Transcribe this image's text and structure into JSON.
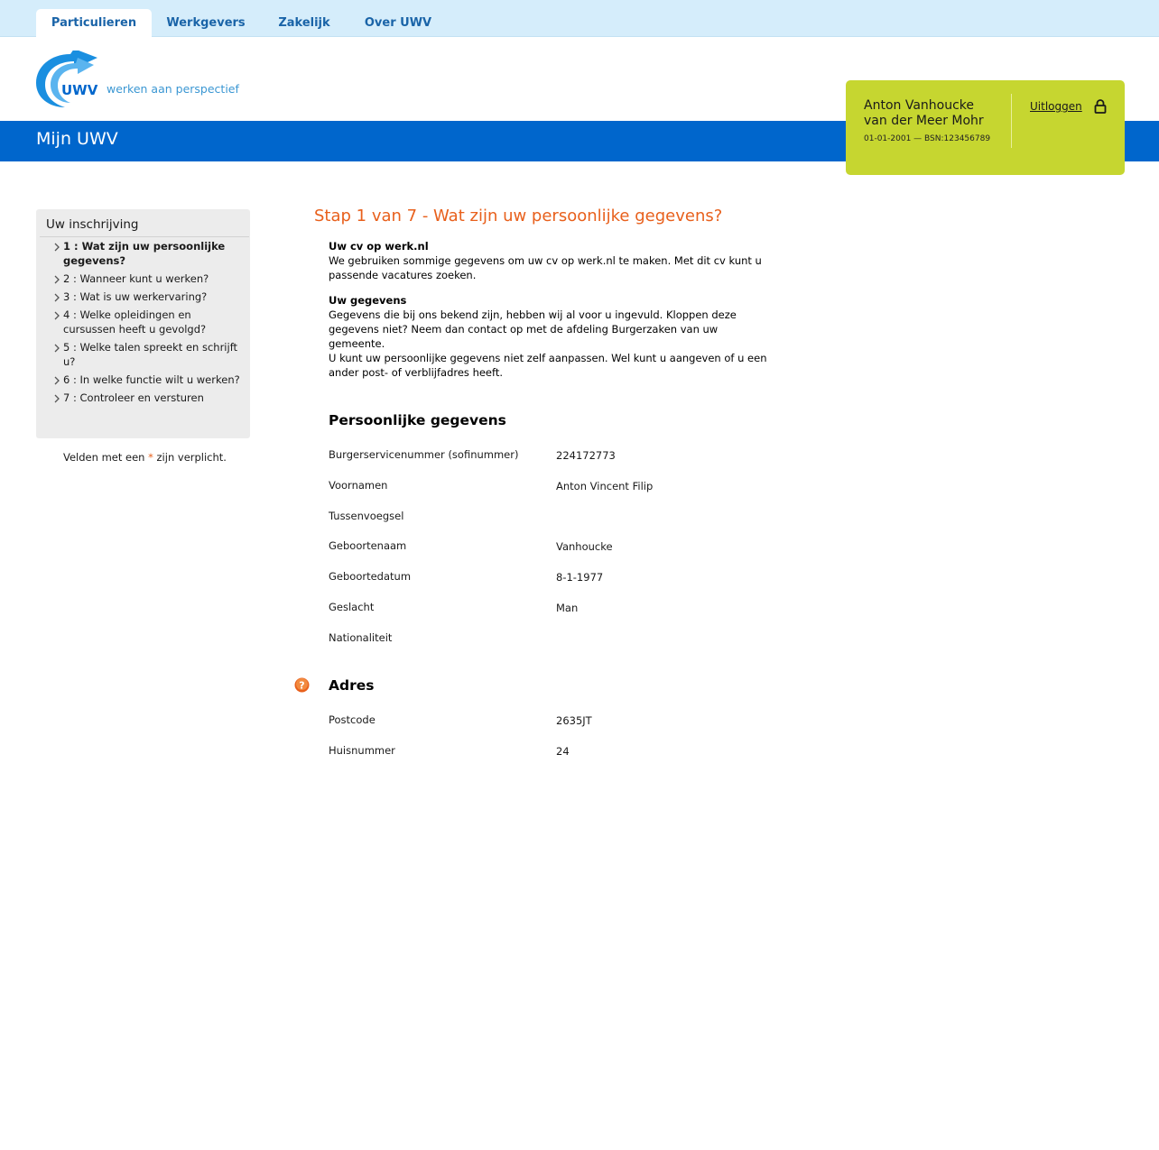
{
  "topnav": {
    "tabs": [
      {
        "label": "Particulieren",
        "active": true
      },
      {
        "label": "Werkgevers",
        "active": false
      },
      {
        "label": "Zakelijk",
        "active": false
      },
      {
        "label": "Over UWV",
        "active": false
      }
    ]
  },
  "logo": {
    "text": "UWV",
    "tagline": "werken aan perspectief"
  },
  "banner": {
    "title": "Mijn UWV"
  },
  "user": {
    "name_line1": "Anton Vanhoucke",
    "name_line2": "van der Meer Mohr",
    "meta": "01-01-2001 — BSN:123456789",
    "logout_label": "Uitloggen",
    "lock_icon": "lock-icon"
  },
  "sidebar": {
    "title": "Uw inschrijving",
    "steps": [
      {
        "label": "1 : Wat zijn uw persoonlijke gegevens?",
        "current": true
      },
      {
        "label": "2 : Wanneer kunt u werken?",
        "current": false
      },
      {
        "label": "3 : Wat is uw werkervaring?",
        "current": false
      },
      {
        "label": "4 : Welke opleidingen en cursussen heeft u gevolgd?",
        "current": false
      },
      {
        "label": "5 : Welke talen spreekt en schrijft u?",
        "current": false
      },
      {
        "label": "6 : In welke functie wilt u werken?",
        "current": false
      },
      {
        "label": "7 : Controleer en versturen",
        "current": false
      }
    ],
    "required_before": "Velden met een ",
    "required_star": "*",
    "required_after": " zijn verplicht."
  },
  "main": {
    "title": "Stap 1 van 7 - Wat zijn uw persoonlijke gegevens?",
    "cv_heading": "Uw cv op werk.nl",
    "cv_text": "We gebruiken sommige gegevens om uw cv op werk.nl te maken. Met dit cv kunt u passende vacatures zoeken.",
    "gegevens_heading": "Uw gegevens",
    "gegevens_text": "Gegevens die bij ons bekend zijn, hebben wij al voor u ingevuld. Kloppen deze gegevens niet? Neem dan contact op met de afdeling Burgerzaken van uw gemeente.",
    "aanpassen_text": "U kunt uw persoonlijke gegevens niet zelf aanpassen. Wel kunt u aangeven of u een ander post- of verblijfadres heeft.",
    "personal": {
      "heading": "Persoonlijke gegevens",
      "rows": [
        {
          "label": "Burgerservicenummer (sofinummer)",
          "value": "224172773"
        },
        {
          "label": "Voornamen",
          "value": "Anton Vincent Filip"
        },
        {
          "label": "Tussenvoegsel",
          "value": ""
        },
        {
          "label": "Geboortenaam",
          "value": "Vanhoucke"
        },
        {
          "label": "Geboortedatum",
          "value": "8-1-1977"
        },
        {
          "label": "Geslacht",
          "value": "Man"
        },
        {
          "label": "Nationaliteit",
          "value": ""
        }
      ]
    },
    "address": {
      "heading": "Adres",
      "help_icon": "help-icon",
      "rows": [
        {
          "label": "Postcode",
          "value": "2635JT"
        },
        {
          "label": "Huisnummer",
          "value": "24"
        }
      ]
    }
  },
  "colors": {
    "brand_blue": "#0066cc",
    "accent_orange": "#e8601c",
    "user_box_green": "#c6d630",
    "topnav_bg": "#d5edfb"
  }
}
